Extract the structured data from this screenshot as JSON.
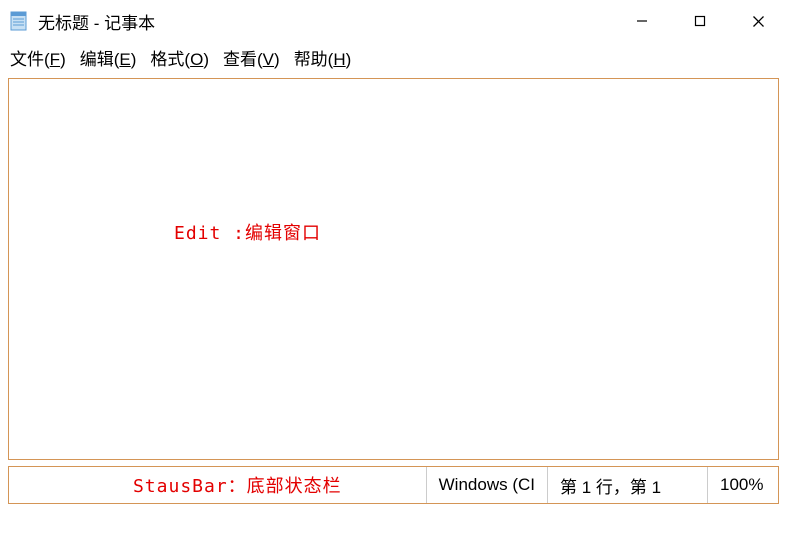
{
  "titlebar": {
    "title": "无标题 - 记事本"
  },
  "menu": {
    "file": "文件(F)",
    "edit": "编辑(E)",
    "format": "格式(O)",
    "view": "查看(V)",
    "help": "帮助(H)"
  },
  "editor": {
    "annotation": "Edit :编辑窗口"
  },
  "statusbar": {
    "annotation": "StausBar：底部状态栏",
    "encoding": "Windows (CI",
    "position": "第 1 行，第 1",
    "zoom": "100%"
  }
}
